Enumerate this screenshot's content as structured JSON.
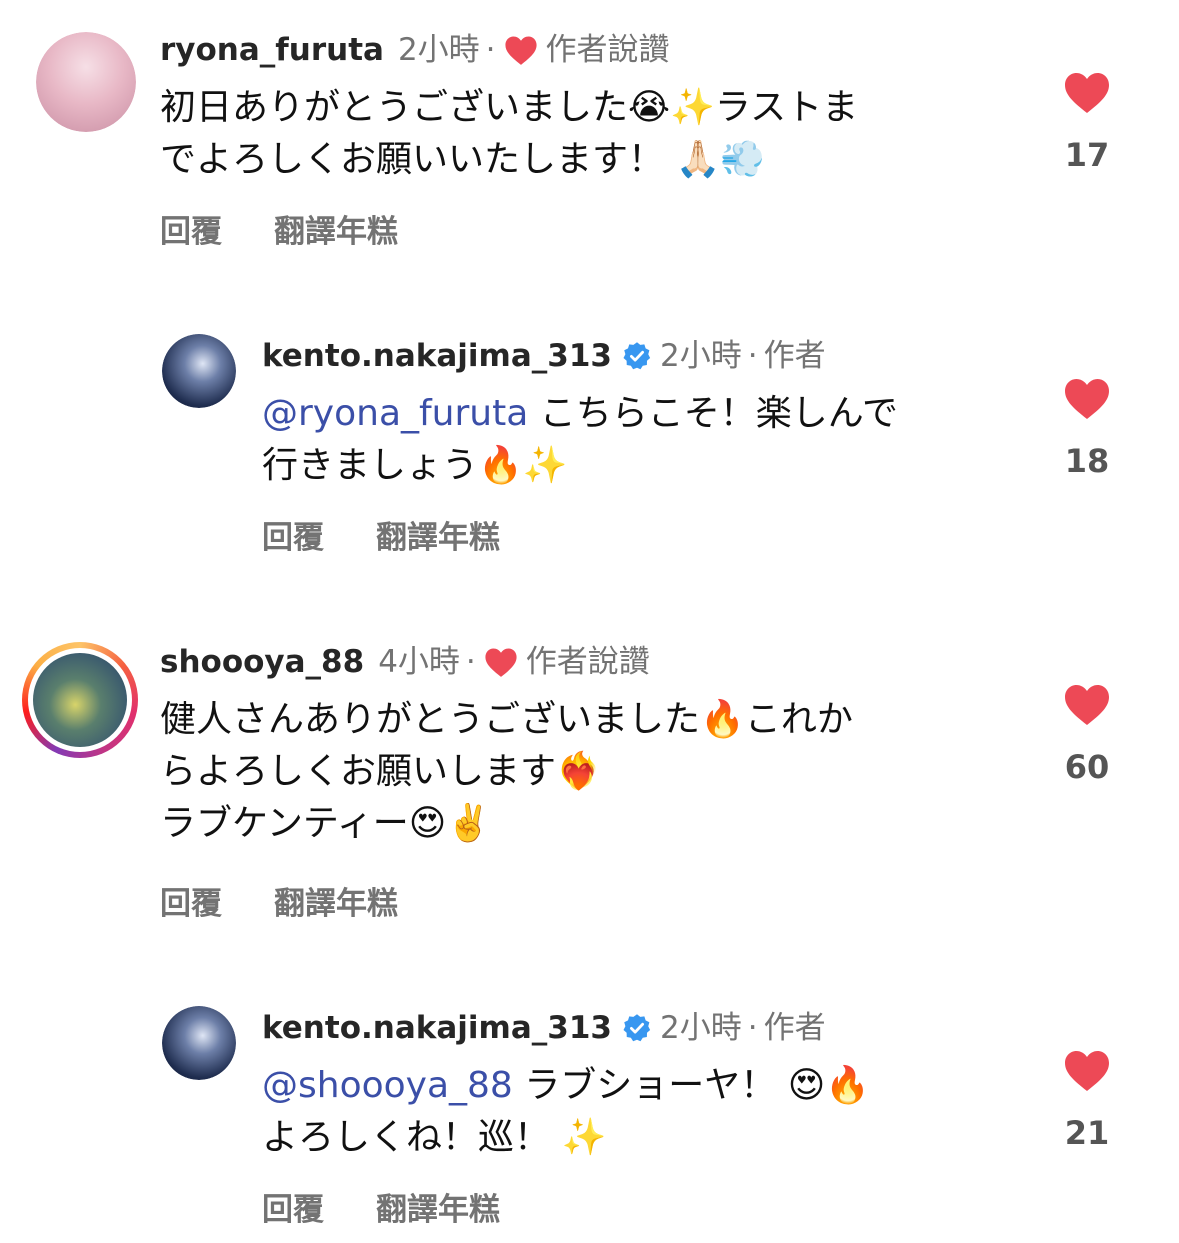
{
  "comments": [
    {
      "username": "ryona_furuta",
      "time": "2小時",
      "sep": "·",
      "author_tag": "作者說讚",
      "line1": "初日ありがとうございました😭✨ラストま",
      "line2": "でよろしくお願いいたします！ 🙏🏻💨",
      "reply": "回覆",
      "translate": "翻譯年糕",
      "likes": "17",
      "avatar_color": "#e9c7d3"
    },
    {
      "username": "kento.nakajima_313",
      "time": "2小時",
      "sep": "·",
      "author_tag": "作者",
      "mention": "@ryona_furuta",
      "line1": " こちらこそ！楽しんで",
      "line2": "行きましょう🔥✨",
      "reply": "回覆",
      "translate": "翻譯年糕",
      "likes": "18",
      "avatar_color": "#1f2d4f"
    },
    {
      "username": "shoooya_88",
      "time": "4小時",
      "sep": "·",
      "author_tag": "作者說讚",
      "line1": "健人さんありがとうございました🔥これか",
      "line2": "らよろしくお願いします❤️‍🔥",
      "line3": "ラブケンティー😍✌️",
      "reply": "回覆",
      "translate": "翻譯年糕",
      "likes": "60",
      "avatar_color": "#4a6b5e"
    },
    {
      "username": "kento.nakajima_313",
      "time": "2小時",
      "sep": "·",
      "author_tag": "作者",
      "mention": "@shoooya_88",
      "line1": " ラブショーヤ！ 😍🔥",
      "line2": "よろしくね！巡！ ✨",
      "reply": "回覆",
      "translate": "翻譯年糕",
      "likes": "21",
      "avatar_color": "#1f2d4f"
    }
  ],
  "colors": {
    "heart": "#ed4956",
    "verified": "#3897f0",
    "mention": "#3b4fa8",
    "muted": "#737373"
  }
}
